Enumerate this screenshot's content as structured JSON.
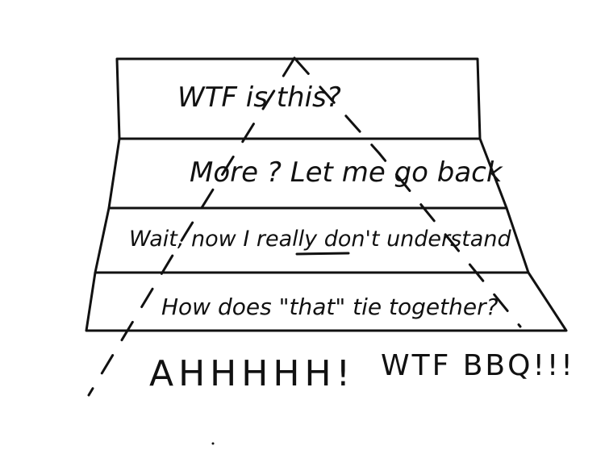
{
  "diagram": {
    "tiers": [
      {
        "text": "WTF is this?"
      },
      {
        "text": "More ? Let me go back"
      },
      {
        "text_before": "Wait, now I ",
        "emphasis": "really",
        "text_after": " don't understand"
      },
      {
        "text": "How does \"that\" tie together?"
      }
    ],
    "bottom": {
      "shout": "AHHHHH!",
      "tag": "WTF BBQ!!!"
    }
  }
}
